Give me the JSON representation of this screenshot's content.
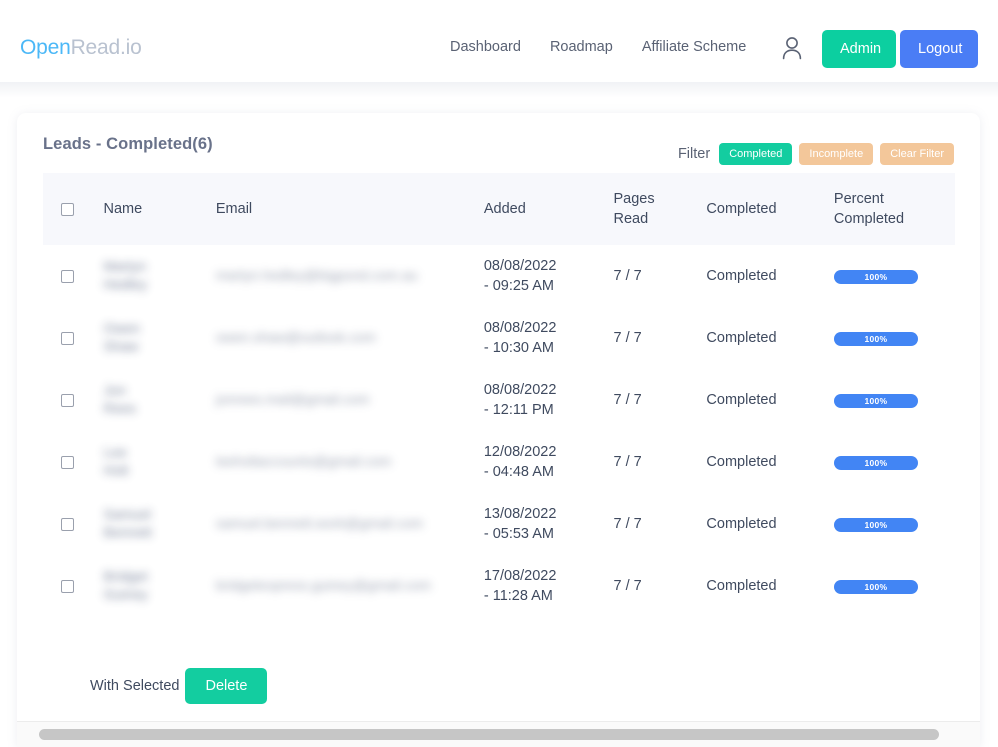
{
  "brand": {
    "name_part1": "Open",
    "name_part2": "Read.io",
    "color_part1": "#4cb8f7",
    "color_part2": "#b9c2d0"
  },
  "nav": {
    "links": [
      {
        "label": "Dashboard"
      },
      {
        "label": "Roadmap"
      },
      {
        "label": "Affiliate Scheme"
      }
    ],
    "user_icon": "person-icon",
    "admin_label": "Admin",
    "logout_label": "Logout",
    "admin_color": "#0ccfa0",
    "logout_color": "#4a7df5"
  },
  "card": {
    "title": "Leads - Completed(6)",
    "filter": {
      "label": "Filter",
      "buttons": [
        {
          "label": "Completed",
          "color": "#13cda0",
          "active": true
        },
        {
          "label": "Incomplete",
          "color": "#f3c79a",
          "active": false
        },
        {
          "label": "Clear Filter",
          "color": "#f3c79a",
          "active": false
        }
      ]
    },
    "table": {
      "columns": [
        {
          "key": "check",
          "label": ""
        },
        {
          "key": "name",
          "label": "Name"
        },
        {
          "key": "email",
          "label": "Email"
        },
        {
          "key": "added",
          "label": "Added"
        },
        {
          "key": "pages",
          "label_line1": "Pages",
          "label_line2": "Read"
        },
        {
          "key": "completed",
          "label": "Completed"
        },
        {
          "key": "percent",
          "label_line1": "Percent",
          "label_line2": "Completed"
        }
      ],
      "rows": [
        {
          "name_line1": "Martyn",
          "name_line2": "Hedley",
          "email": "martyn.hedley@bigpond.com.au",
          "added_date": "08/08/2022",
          "added_time": "- 09:25 AM",
          "pages_read": "7 / 7",
          "completed": "Completed",
          "percent": "100%",
          "redacted": true
        },
        {
          "name_line1": "Owen",
          "name_line2": "Shaw",
          "email": "owen.shaw@outlook.com",
          "added_date": "08/08/2022",
          "added_time": "- 10:30 AM",
          "pages_read": "7 / 7",
          "completed": "Completed",
          "percent": "100%",
          "redacted": true
        },
        {
          "name_line1": "Jon",
          "name_line2": "Rees",
          "email": "jonrees.mail@gmail.com",
          "added_date": "08/08/2022",
          "added_time": "- 12:11 PM",
          "pages_read": "7 / 7",
          "completed": "Completed",
          "percent": "100%",
          "redacted": true
        },
        {
          "name_line1": "Lee",
          "name_line2": "Holt",
          "email": "leeholtaccounts@gmail.com",
          "added_date": "12/08/2022",
          "added_time": "- 04:48 AM",
          "pages_read": "7 / 7",
          "completed": "Completed",
          "percent": "100%",
          "redacted": true
        },
        {
          "name_line1": "Samuel",
          "name_line2": "Bennett",
          "email": "samuel.bennett.work@gmail.com",
          "added_date": "13/08/2022",
          "added_time": "- 05:53 AM",
          "pages_read": "7 / 7",
          "completed": "Completed",
          "percent": "100%",
          "redacted": true
        },
        {
          "name_line1": "Bridget",
          "name_line2": "Guiney",
          "email": "bridgetexpress.guiney@gmail.com",
          "added_date": "17/08/2022",
          "added_time": "- 11:28 AM",
          "pages_read": "7 / 7",
          "completed": "Completed",
          "percent": "100%",
          "redacted": true
        }
      ]
    },
    "bulk": {
      "label": "With Selected",
      "delete_label": "Delete",
      "delete_color": "#13cda0"
    }
  },
  "scrollbar": {
    "orientation": "horizontal",
    "thumb_color": "#c6c6c6"
  }
}
